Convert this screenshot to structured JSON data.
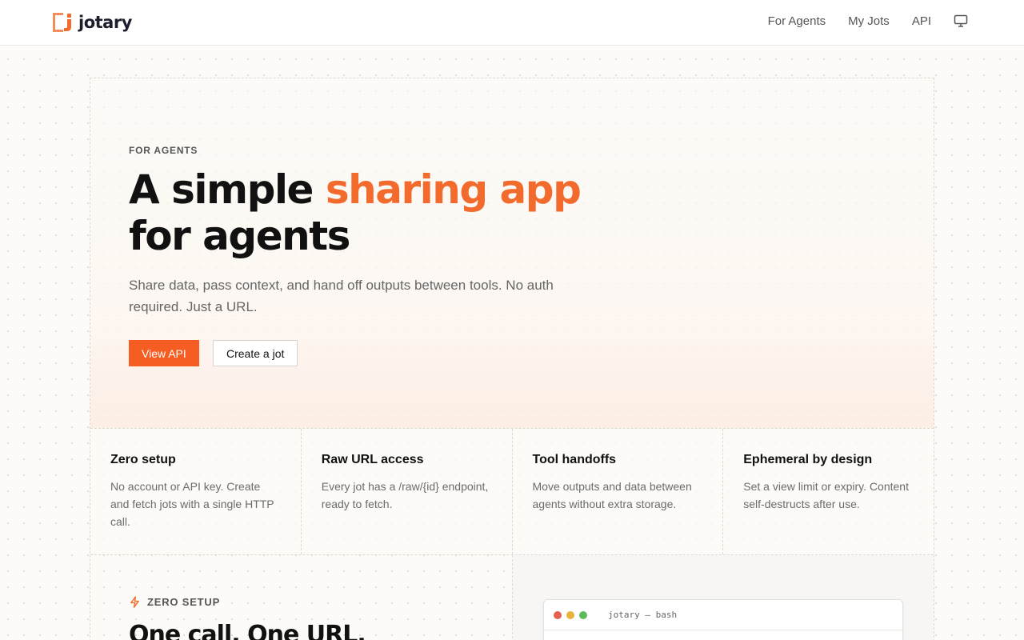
{
  "brand": {
    "name": "jotary",
    "accent_color": "#f26a2c"
  },
  "nav": {
    "items": [
      "For Agents",
      "My Jots",
      "API"
    ],
    "display_icon": "monitor-icon"
  },
  "hero": {
    "eyebrow": "FOR AGENTS",
    "title_part1": "A simple ",
    "title_accent": "sharing app",
    "title_part2": "for agents",
    "subtitle": "Share data, pass context, and hand off outputs between tools. No auth required. Just a URL.",
    "primary_button": "View API",
    "secondary_button": "Create a jot"
  },
  "features": [
    {
      "title": "Zero setup",
      "desc": "No account or API key. Create and fetch jots with a single HTTP call."
    },
    {
      "title": "Raw URL access",
      "desc": "Every jot has a /raw/{id} endpoint, ready to fetch."
    },
    {
      "title": "Tool handoffs",
      "desc": "Move outputs and data between agents without extra storage."
    },
    {
      "title": "Ephemeral by design",
      "desc": "Set a view limit or expiry. Content self-destructs after use."
    }
  ],
  "zero_setup": {
    "eyebrow": "ZERO SETUP",
    "icon": "bolt-icon",
    "title": "One call. One URL."
  },
  "terminal": {
    "title": "jotary — bash",
    "dot_colors": [
      "#e5604f",
      "#e8b33c",
      "#5dbb5a"
    ]
  }
}
